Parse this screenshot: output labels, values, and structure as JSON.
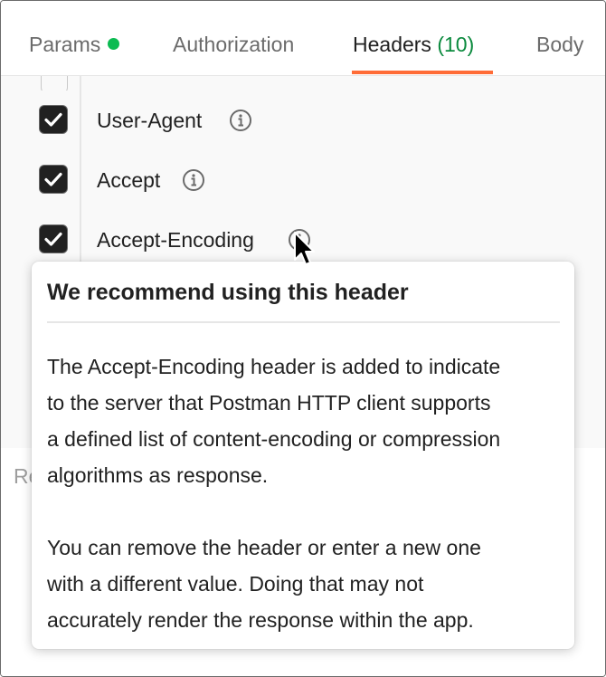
{
  "tabs": {
    "params": "Params",
    "authorization": "Authorization",
    "headers": "Headers",
    "headers_count": "(10)",
    "body": "Body"
  },
  "colors": {
    "accent_orange": "#ff6c37",
    "status_green": "#0cbb52",
    "count_green": "#0b8a3e"
  },
  "headers_table": {
    "rows": [
      {
        "key": "User-Agent",
        "checked": true,
        "icon": "info-icon"
      },
      {
        "key": "Accept",
        "checked": true,
        "icon": "info-icon"
      },
      {
        "key": "Accept-Encoding",
        "checked": true,
        "icon": "info-icon"
      }
    ],
    "lower_partial_text": "Re"
  },
  "tooltip": {
    "title": "We recommend using this header",
    "lines_1": [
      "The Accept-Encoding header is added to indicate",
      "to the server that Postman HTTP client supports",
      "a defined list of content-encoding or compression",
      "algorithms as response."
    ],
    "lines_2": [
      "You can remove the header or enter a new one",
      "with a different value. Doing that may not",
      "accurately render the response within the app."
    ]
  }
}
